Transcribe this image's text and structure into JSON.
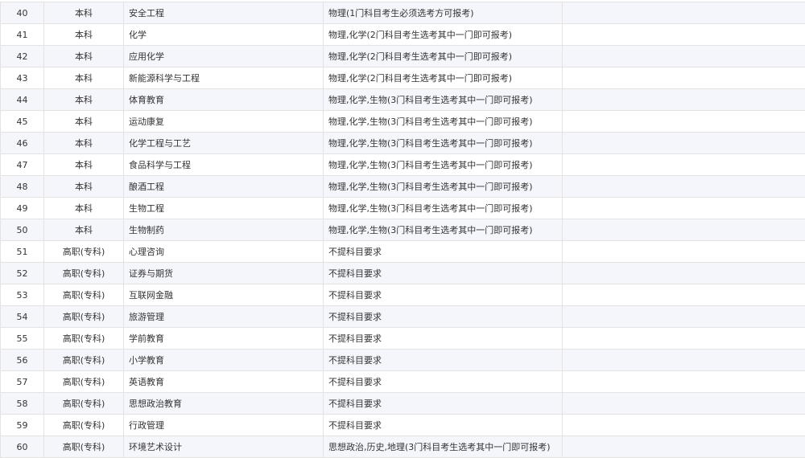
{
  "table": {
    "rows": [
      {
        "index": "40",
        "level": "本科",
        "major": "安全工程",
        "requirement": "物理(1门科目考生必须选考方可报考)"
      },
      {
        "index": "41",
        "level": "本科",
        "major": "化学",
        "requirement": "物理,化学(2门科目考生选考其中一门即可报考)"
      },
      {
        "index": "42",
        "level": "本科",
        "major": "应用化学",
        "requirement": "物理,化学(2门科目考生选考其中一门即可报考)"
      },
      {
        "index": "43",
        "level": "本科",
        "major": "新能源科学与工程",
        "requirement": "物理,化学(2门科目考生选考其中一门即可报考)"
      },
      {
        "index": "44",
        "level": "本科",
        "major": "体育教育",
        "requirement": "物理,化学,生物(3门科目考生选考其中一门即可报考)"
      },
      {
        "index": "45",
        "level": "本科",
        "major": "运动康复",
        "requirement": "物理,化学,生物(3门科目考生选考其中一门即可报考)"
      },
      {
        "index": "46",
        "level": "本科",
        "major": "化学工程与工艺",
        "requirement": "物理,化学,生物(3门科目考生选考其中一门即可报考)"
      },
      {
        "index": "47",
        "level": "本科",
        "major": "食品科学与工程",
        "requirement": "物理,化学,生物(3门科目考生选考其中一门即可报考)"
      },
      {
        "index": "48",
        "level": "本科",
        "major": "酿酒工程",
        "requirement": "物理,化学,生物(3门科目考生选考其中一门即可报考)"
      },
      {
        "index": "49",
        "level": "本科",
        "major": "生物工程",
        "requirement": "物理,化学,生物(3门科目考生选考其中一门即可报考)"
      },
      {
        "index": "50",
        "level": "本科",
        "major": "生物制药",
        "requirement": "物理,化学,生物(3门科目考生选考其中一门即可报考)"
      },
      {
        "index": "51",
        "level": "高职(专科)",
        "major": "心理咨询",
        "requirement": "不提科目要求"
      },
      {
        "index": "52",
        "level": "高职(专科)",
        "major": "证券与期货",
        "requirement": "不提科目要求"
      },
      {
        "index": "53",
        "level": "高职(专科)",
        "major": "互联网金融",
        "requirement": "不提科目要求"
      },
      {
        "index": "54",
        "level": "高职(专科)",
        "major": "旅游管理",
        "requirement": "不提科目要求"
      },
      {
        "index": "55",
        "level": "高职(专科)",
        "major": "学前教育",
        "requirement": "不提科目要求"
      },
      {
        "index": "56",
        "level": "高职(专科)",
        "major": "小学教育",
        "requirement": "不提科目要求"
      },
      {
        "index": "57",
        "level": "高职(专科)",
        "major": "英语教育",
        "requirement": "不提科目要求"
      },
      {
        "index": "58",
        "level": "高职(专科)",
        "major": "思想政治教育",
        "requirement": "不提科目要求"
      },
      {
        "index": "59",
        "level": "高职(专科)",
        "major": "行政管理",
        "requirement": "不提科目要求"
      },
      {
        "index": "60",
        "level": "高职(专科)",
        "major": "环境艺术设计",
        "requirement": "思想政治,历史,地理(3门科目考生选考其中一门即可报考)"
      }
    ]
  },
  "colors": {
    "row_odd": "#f5f6fc",
    "row_even": "#ffffff",
    "border": "#e3e3e3",
    "text": "#333333"
  }
}
